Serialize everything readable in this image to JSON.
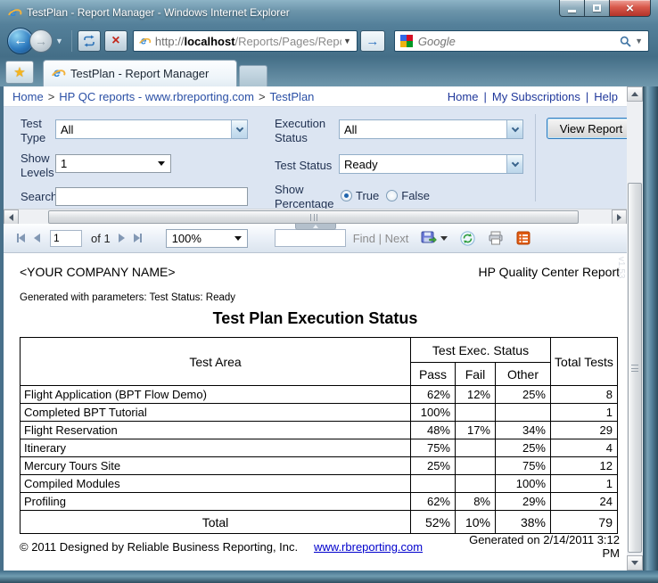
{
  "window": {
    "title": "TestPlan - Report Manager - Windows Internet Explorer"
  },
  "nav": {
    "url": {
      "protocol": "http://",
      "host": "localhost",
      "path": "/Reports/Pages/Report."
    },
    "search": {
      "placeholder": "Google"
    }
  },
  "tab": {
    "title": "TestPlan - Report Manager"
  },
  "breadcrumb": {
    "items": [
      "Home",
      "HP QC reports - www.rbreporting.com",
      "TestPlan"
    ],
    "separator": ">",
    "right_links": [
      "Home",
      "My Subscriptions",
      "Help"
    ],
    "right_divider": "|"
  },
  "params": {
    "test_type_label": "Test Type",
    "test_type_value": "All",
    "execution_status_label": "Execution Status",
    "execution_status_value": "All",
    "show_levels_label": "Show Levels",
    "show_levels_value": "1",
    "test_status_label": "Test Status",
    "test_status_value": "Ready",
    "search_label": "Search",
    "search_value": "",
    "show_percentage_label": "Show Percentage",
    "radio_true_label": "True",
    "radio_false_label": "False",
    "show_percentage_selected": "True",
    "view_report_label": "View Report"
  },
  "toolbar": {
    "page_value": "1",
    "page_of": "of 1",
    "zoom_value": "100%",
    "find_label": "Find",
    "divider": "|",
    "next_label": "Next"
  },
  "report": {
    "company": "<YOUR COMPANY NAME>",
    "header_right": "HP Quality Center Report",
    "generated_params": "Generated with parameters: Test Status: Ready",
    "title": "Test Plan Execution Status",
    "watermark": "v1.53",
    "footer": {
      "copyright": "© 2011 Designed by Reliable Business Reporting, Inc.",
      "link": "www.rbreporting.com",
      "generated": "Generated on 2/14/2011 3:12 PM"
    }
  },
  "chart_data": {
    "type": "table",
    "title": "Test Plan Execution Status",
    "group_header": "Test Exec. Status",
    "columns": [
      "Test Area",
      "Pass",
      "Fail",
      "Other",
      "Total Tests"
    ],
    "rows": [
      [
        "Flight Application (BPT Flow Demo)",
        "62%",
        "12%",
        "25%",
        "8"
      ],
      [
        "Completed BPT Tutorial",
        "100%",
        "",
        "",
        "1"
      ],
      [
        "Flight Reservation",
        "48%",
        "17%",
        "34%",
        "29"
      ],
      [
        "Itinerary",
        "75%",
        "",
        "25%",
        "4"
      ],
      [
        "Mercury Tours Site",
        "25%",
        "",
        "75%",
        "12"
      ],
      [
        "Compiled Modules",
        "",
        "",
        "100%",
        "1"
      ],
      [
        "Profiling",
        "62%",
        "8%",
        "29%",
        "24"
      ]
    ],
    "total": [
      "Total",
      "52%",
      "10%",
      "38%",
      "79"
    ]
  },
  "colors": {
    "titlebar_teal": "#5e89a0",
    "params_panel": "#dce5f2",
    "link_blue": "#2a4fa5",
    "footer_link_blue": "#0000cc",
    "close_button_red": "#c0392b",
    "export_icon_orange": "#e05a12"
  }
}
